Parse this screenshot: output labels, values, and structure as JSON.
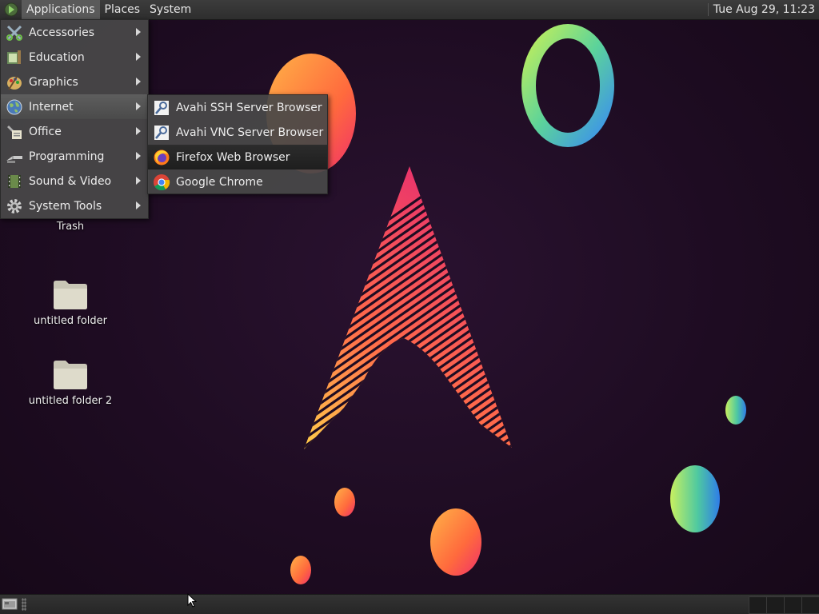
{
  "top_panel": {
    "menus": [
      "Applications",
      "Places",
      "System"
    ],
    "clock": "Tue Aug 29, 11:23"
  },
  "applications_menu": {
    "items": [
      {
        "label": "Accessories",
        "icon": "accessories-icon"
      },
      {
        "label": "Education",
        "icon": "education-icon"
      },
      {
        "label": "Graphics",
        "icon": "graphics-icon"
      },
      {
        "label": "Internet",
        "icon": "internet-icon"
      },
      {
        "label": "Office",
        "icon": "office-icon"
      },
      {
        "label": "Programming",
        "icon": "programming-icon"
      },
      {
        "label": "Sound & Video",
        "icon": "sound-video-icon"
      },
      {
        "label": "System Tools",
        "icon": "system-tools-icon"
      }
    ],
    "open_item": "Internet"
  },
  "internet_submenu": {
    "items": [
      {
        "label": "Avahi SSH Server Browser",
        "icon": "avahi-ssh-icon"
      },
      {
        "label": "Avahi VNC Server Browser",
        "icon": "avahi-vnc-icon"
      },
      {
        "label": "Firefox Web Browser",
        "icon": "firefox-icon"
      },
      {
        "label": "Google Chrome",
        "icon": "chrome-icon"
      }
    ],
    "highlighted_item": "Firefox Web Browser"
  },
  "desktop": {
    "icons": [
      {
        "label": "Trash",
        "icon": "trash-icon"
      },
      {
        "label": "untitled folder",
        "icon": "folder-icon"
      },
      {
        "label": "untitled folder 2",
        "icon": "folder-icon"
      }
    ]
  },
  "colors": {
    "background": "#1e0c22",
    "panel": "#333333",
    "menu": "#484848",
    "accent_pink": "#e8306e",
    "accent_orange": "#ff9a3c"
  }
}
